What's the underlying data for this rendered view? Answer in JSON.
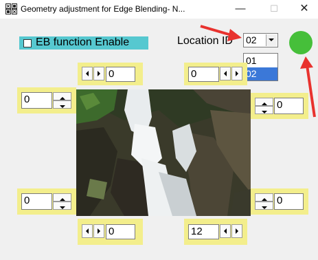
{
  "window": {
    "title": "Geometry adjustment for Edge Blending- N..."
  },
  "eb": {
    "label": "EB function Enable",
    "checked": false
  },
  "location": {
    "label": "Location ID",
    "selected": "02",
    "options": [
      "01",
      "02"
    ]
  },
  "status": {
    "color": "#46bf3a"
  },
  "colors": {
    "frame": "#f3ee8c",
    "checkbox_bg": "#56c8d0",
    "selected_option": "#3b78d8"
  },
  "controls": {
    "top_left": "0",
    "top_right": "0",
    "left_top": "0",
    "right_top": "0",
    "left_bottom": "0",
    "right_bottom": "0",
    "bottom_left": "0",
    "bottom_right": "12"
  }
}
